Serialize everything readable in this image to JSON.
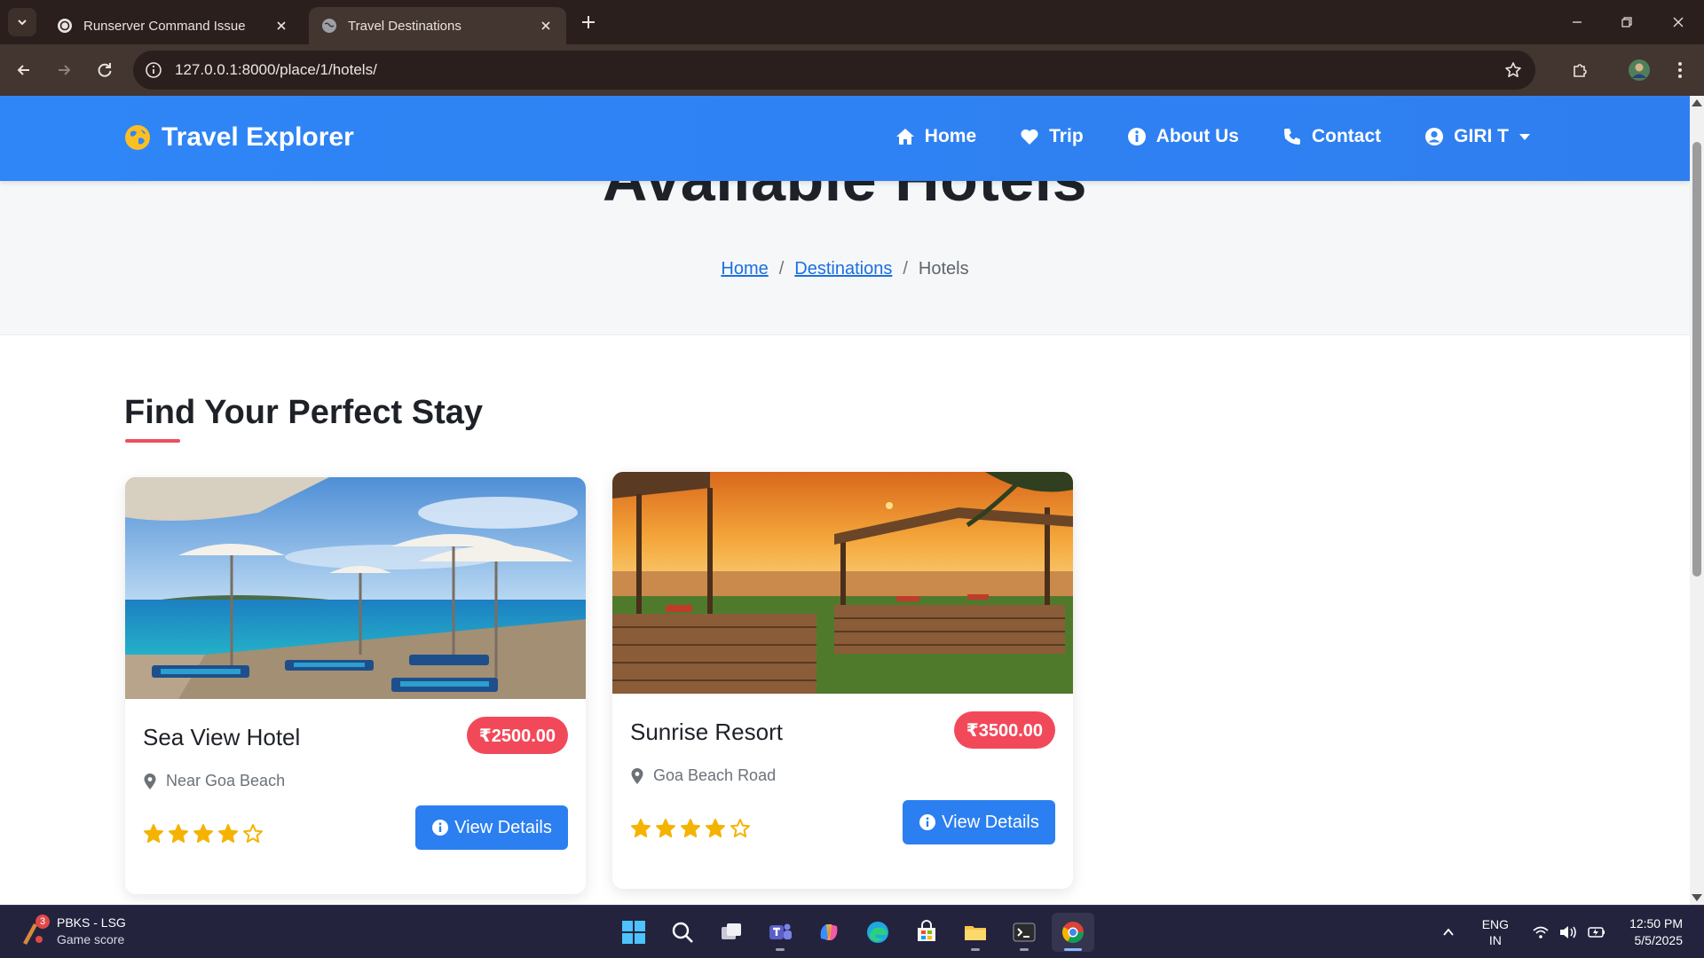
{
  "browser": {
    "tabs": [
      {
        "title": "Runserver Command Issue",
        "active": false
      },
      {
        "title": "Travel Destinations",
        "active": true
      }
    ],
    "url": "127.0.0.1:8000/place/1/hotels/"
  },
  "navbar": {
    "brand": "Travel Explorer",
    "links": [
      {
        "label": "Home",
        "icon": "home-icon"
      },
      {
        "label": "Trip",
        "icon": "heart-icon"
      },
      {
        "label": "About Us",
        "icon": "info-icon"
      },
      {
        "label": "Contact",
        "icon": "phone-icon"
      },
      {
        "label": "GIRI T",
        "icon": "user-circle-icon"
      }
    ]
  },
  "hero": {
    "title": "Available Hotels",
    "breadcrumb": {
      "home": "Home",
      "destinations": "Destinations",
      "current": "Hotels",
      "separator": "/"
    }
  },
  "section": {
    "title": "Find Your Perfect Stay"
  },
  "hotels": [
    {
      "name": "Sea View Hotel",
      "price": "₹2500.00",
      "location": "Near Goa Beach",
      "rating": 4,
      "max_rating": 5,
      "button": "View Details"
    },
    {
      "name": "Sunrise Resort",
      "price": "₹3500.00",
      "location": "Goa Beach Road",
      "rating": 4,
      "max_rating": 5,
      "button": "View Details"
    }
  ],
  "taskbar": {
    "widget": {
      "title": "PBKS - LSG",
      "subtitle": "Game score",
      "badge": "3"
    },
    "lang": {
      "line1": "ENG",
      "line2": "IN"
    },
    "clock": {
      "time": "12:50 PM",
      "date": "5/5/2025"
    }
  },
  "colors": {
    "navbar": "#2f86f6",
    "price_badge": "#f2495a",
    "button": "#2b7ff0",
    "star": "#f5b301",
    "underline": "#ef4d5d"
  }
}
